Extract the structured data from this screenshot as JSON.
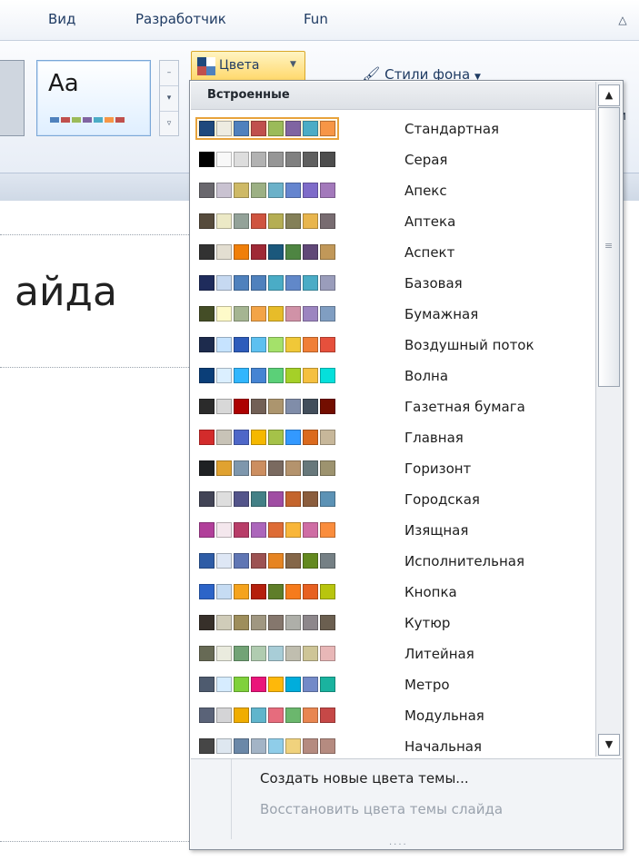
{
  "ribbon": {
    "tabs": [
      "Вид",
      "Разработчик",
      "Fun"
    ],
    "theme_thumb_label": "Aa",
    "theme_thumb_stripe": [
      "#4f81bd",
      "#c0504d",
      "#9bbb59",
      "#8064a2",
      "#4bacc6",
      "#f79646",
      "#c0504d"
    ],
    "colors_button_label": "Цвета",
    "bg_styles_label": "Стили фона",
    "right_edge_text": "и"
  },
  "slide": {
    "title_fragment": "айда"
  },
  "dropdown": {
    "header": "Встроенные",
    "items": [
      {
        "name": "Стандартная",
        "colors": [
          "#1f497d",
          "#eeece1",
          "#4f81bd",
          "#c0504d",
          "#9bbb59",
          "#8064a2",
          "#4bacc6",
          "#f79646"
        ],
        "selected": true
      },
      {
        "name": "Серая",
        "colors": [
          "#000000",
          "#f8f8f8",
          "#dddddd",
          "#b2b2b2",
          "#969696",
          "#808080",
          "#5f5f5f",
          "#4d4d4d"
        ]
      },
      {
        "name": "Апекс",
        "colors": [
          "#69676d",
          "#c9c2d1",
          "#ceb966",
          "#9cb084",
          "#6bb1c9",
          "#6585cf",
          "#7e6bc9",
          "#a379bb"
        ]
      },
      {
        "name": "Аптека",
        "colors": [
          "#564b3c",
          "#ece9c6",
          "#93a299",
          "#cf543f",
          "#b5ae53",
          "#848058",
          "#e8b54d",
          "#786c71"
        ]
      },
      {
        "name": "Аспект",
        "colors": [
          "#323232",
          "#e3ded1",
          "#f07f09",
          "#9f2936",
          "#1b587c",
          "#4e8542",
          "#604878",
          "#c19859"
        ]
      },
      {
        "name": "Базовая",
        "colors": [
          "#1f2c5c",
          "#c6d9f1",
          "#4f81bd",
          "#4f81bd",
          "#4aacc6",
          "#6188c9",
          "#4bacc6",
          "#9a9dbb"
        ]
      },
      {
        "name": "Бумажная",
        "colors": [
          "#444d26",
          "#fefac9",
          "#a5b592",
          "#f3a447",
          "#e7bc29",
          "#d092a7",
          "#9c85c0",
          "#809ec2"
        ]
      },
      {
        "name": "Воздушный поток",
        "colors": [
          "#1d2b4d",
          "#c6e3ff",
          "#2e5cbb",
          "#5dc0f0",
          "#a4e16a",
          "#f0c838",
          "#f07f37",
          "#e6503c"
        ]
      },
      {
        "name": "Волна",
        "colors": [
          "#0a3e78",
          "#dbefff",
          "#31b6fd",
          "#4584d3",
          "#5bd078",
          "#a5d028",
          "#f5c040",
          "#05e0db"
        ]
      },
      {
        "name": "Газетная бумага",
        "colors": [
          "#2b2b2b",
          "#d8d8d8",
          "#ad0101",
          "#726056",
          "#ac956e",
          "#808da9",
          "#424e5b",
          "#730e00"
        ]
      },
      {
        "name": "Главная",
        "colors": [
          "#d32b2b",
          "#c8c3b7",
          "#4e67c8",
          "#f5b800",
          "#a5c249",
          "#3399ff",
          "#db6a1e",
          "#c7b79a"
        ]
      },
      {
        "name": "Горизонт",
        "colors": [
          "#1f2123",
          "#e0a230",
          "#7e97ad",
          "#cc8e60",
          "#7a6a60",
          "#b4936d",
          "#67787b",
          "#9d936f"
        ]
      },
      {
        "name": "Городская",
        "colors": [
          "#424456",
          "#dedede",
          "#53548a",
          "#438086",
          "#a04da3",
          "#c4652d",
          "#8b5d3d",
          "#5c92b5"
        ]
      },
      {
        "name": "Изящная",
        "colors": [
          "#b13f9a",
          "#f4e7ed",
          "#b83d68",
          "#ac66bb",
          "#de6c36",
          "#f9b639",
          "#cf6da4",
          "#fa8d3d"
        ]
      },
      {
        "name": "Исполнительная",
        "colors": [
          "#2e5ca6",
          "#dee7f5",
          "#6076b4",
          "#9c5252",
          "#e68422",
          "#846648",
          "#63891f",
          "#758085"
        ]
      },
      {
        "name": "Кнопка",
        "colors": [
          "#2c64c8",
          "#c6dcf3",
          "#f5a31d",
          "#b5200d",
          "#5f7e29",
          "#f67b1c",
          "#e76021",
          "#b8c50e"
        ]
      },
      {
        "name": "Кутюр",
        "colors": [
          "#37302a",
          "#d0ccb9",
          "#9e8e5c",
          "#a09781",
          "#85776d",
          "#aeafa9",
          "#8d878b",
          "#6b5f50"
        ]
      },
      {
        "name": "Литейная",
        "colors": [
          "#676a55",
          "#eaebde",
          "#72a376",
          "#b0ccb0",
          "#a8cdd7",
          "#c0beaf",
          "#cec597",
          "#e8b7b7"
        ]
      },
      {
        "name": "Метро",
        "colors": [
          "#4e5b6f",
          "#d6ecff",
          "#7fd13b",
          "#ea157a",
          "#feb80a",
          "#00addc",
          "#738ac8",
          "#1ab39f"
        ]
      },
      {
        "name": "Модульная",
        "colors": [
          "#5a6378",
          "#d4d4d6",
          "#f0ad00",
          "#60b5cc",
          "#e66c7d",
          "#6bb76d",
          "#e88651",
          "#c64847"
        ]
      },
      {
        "name": "Начальная",
        "colors": [
          "#464646",
          "#dee7f0",
          "#6b88a8",
          "#a3b4c6",
          "#8fcde9",
          "#f0d27d",
          "#b58b80",
          "#b58b80"
        ]
      }
    ],
    "commands": {
      "create": "Создать новые цвета темы...",
      "restore": "Восстановить цвета темы слайда"
    },
    "scrollbar": {
      "up": "▲",
      "down": "▼",
      "grip": "≡"
    },
    "resize_grip": "....",
    "selection_color": "#e8a33b"
  }
}
